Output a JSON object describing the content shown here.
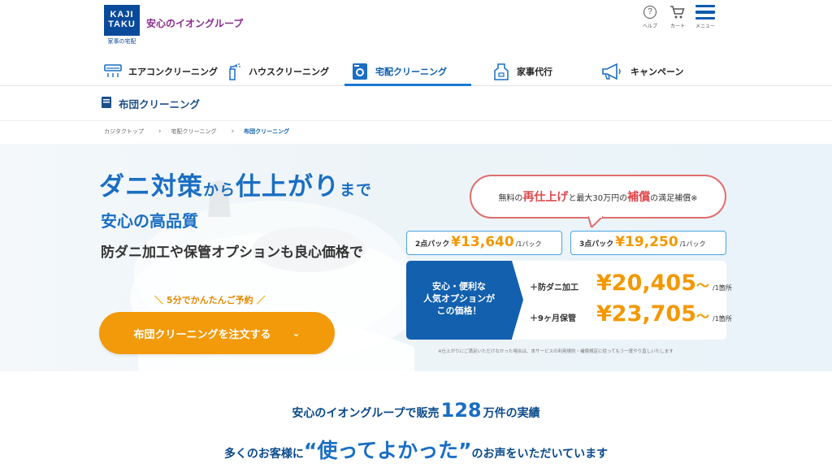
{
  "header": {
    "logo_line1": "KAJI",
    "logo_line2": "TAKU",
    "logo_sub": "家事の宅配",
    "tagline": "安心のイオングループ",
    "help_label": "ヘルプ",
    "cart_label": "カート",
    "menu_label": "メニュー"
  },
  "nav": {
    "items": [
      {
        "label": "エアコンクリーニング",
        "icon": "aircon-icon"
      },
      {
        "label": "ハウスクリーニング",
        "icon": "spray-icon"
      },
      {
        "label": "宅配クリーニング",
        "icon": "washer-icon"
      },
      {
        "label": "家事代行",
        "icon": "apron-icon"
      },
      {
        "label": "キャンペーン",
        "icon": "megaphone-icon"
      }
    ],
    "active_index": 2
  },
  "page_title": "布団クリーニング",
  "breadcrumb": [
    "カジタクトップ",
    "宅配クリーニング",
    "布団クリーニング"
  ],
  "hero": {
    "headline_a": "ダニ対策",
    "headline_b": "から",
    "headline_c": "仕上がり",
    "headline_d": "まで",
    "subhead": "安心の高品質",
    "tagline": "防ダニ加工や保管オプションも良心価格で",
    "reserve_note": "5分でかんたんご予約",
    "cta_label": "布団クリーニングを注文する"
  },
  "bubble": {
    "pre": "無料の",
    "em1": "再仕上げ",
    "mid": "と最大30万円の",
    "em2": "補償",
    "post": "の満足補償※"
  },
  "packs": [
    {
      "name": "2点パック",
      "price": "¥13,640",
      "unit": "/1パック"
    },
    {
      "name": "3点パック",
      "price": "¥19,250",
      "unit": "/1パック"
    }
  ],
  "options": {
    "lead_line1": "安心・便利な",
    "lead_line2": "人気オプションが",
    "lead_line3": "この価格！",
    "rows": [
      {
        "label": "＋防ダニ加工",
        "price": "¥20,405",
        "tilde": "〜",
        "unit": "/1箇所"
      },
      {
        "label": "＋9ヶ月保管",
        "price": "¥23,705",
        "tilde": "〜",
        "unit": "/1箇所"
      }
    ]
  },
  "fine_print": "※仕上がりにご満足いただけなかった場合は、本サービスの利用規約・補償規定に従ってもう一度やり直しいたします",
  "stats": {
    "pre": "安心のイオングループで販売",
    "number": "128",
    "post": "万件の実績"
  },
  "voice": {
    "pre": "多くのお客様に",
    "quote": "“使ってよかった”",
    "post": "のお声をいただいています"
  },
  "colors": {
    "brand_blue": "#1a6ec3",
    "navy": "#0a4a9a",
    "orange": "#f39800",
    "accent_red": "#e0474c",
    "purple": "#8b2c8f"
  }
}
